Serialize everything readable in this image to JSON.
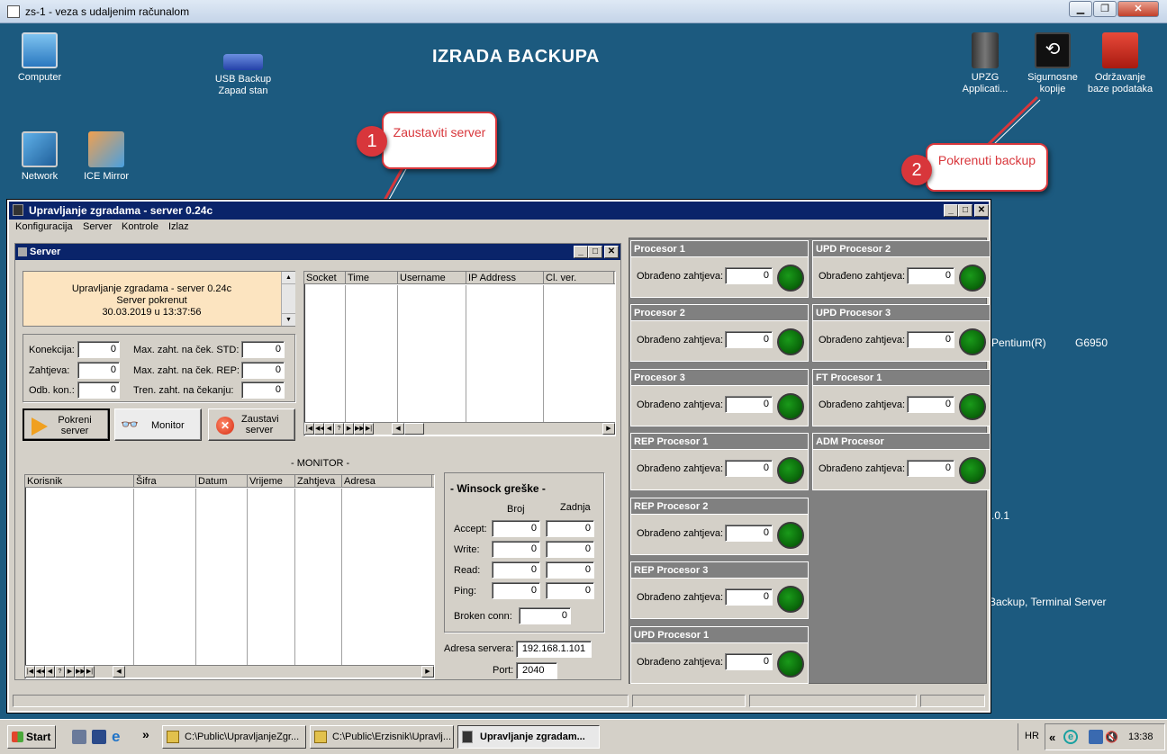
{
  "rdp": {
    "title": "zs-1 - veza s udaljenim računalom",
    "minimize": "▁",
    "restore": "❐",
    "close": "✕"
  },
  "desktop": {
    "banner": "IZRADA BACKUPA",
    "icons": [
      {
        "label": "Computer",
        "icon": "computer-icon"
      },
      {
        "label": "USB Backup Zapad stan",
        "icon": "usb-drive-icon"
      },
      {
        "label": "Network",
        "icon": "network-icon"
      },
      {
        "label": "ICE Mirror",
        "icon": "ice-mirror-icon"
      },
      {
        "label": "UPZG Applicati...",
        "icon": "server-tower-icon"
      },
      {
        "label": "Sigurnosne kopije",
        "icon": "backup-clock-icon"
      },
      {
        "label": "Održavanje baze podataka",
        "icon": "toolbox-icon"
      }
    ],
    "bg_fragments": [
      "Pentium(R)",
      "G6950",
      ".0.1",
      "Backup, Terminal Server"
    ]
  },
  "callouts": [
    {
      "number": "1",
      "text": "Zaustaviti server"
    },
    {
      "number": "2",
      "text": "Pokrenuti backup"
    }
  ],
  "app": {
    "title": "Upravljanje zgradama - server 0.24c",
    "menu": [
      "Konfiguracija",
      "Server",
      "Kontrole",
      "Izlaz"
    ]
  },
  "server": {
    "title": "Server",
    "status_lines": [
      "Upravljanje zgradama - server 0.24c",
      "Server pokrenut",
      "30.03.2019 u 13:37:56"
    ],
    "stats_left": [
      {
        "label": "Konekcija:",
        "value": "0"
      },
      {
        "label": "Zahtjeva:",
        "value": "0"
      },
      {
        "label": "Odb. kon.:",
        "value": "0"
      }
    ],
    "stats_right": [
      {
        "label": "Max. zaht. na ček. STD:",
        "value": "0"
      },
      {
        "label": "Max. zaht. na ček. REP:",
        "value": "0"
      },
      {
        "label": "Tren. zaht. na čekanju:",
        "value": "0"
      }
    ],
    "buttons": {
      "start": "Pokreni server",
      "monitor": "Monitor",
      "stop": "Zaustavi server"
    },
    "conn_columns": [
      "Socket",
      "Time",
      "Username",
      "IP Address",
      "Cl. ver."
    ],
    "monitor_title": "- MONITOR -",
    "monitor_columns": [
      "Korisnik",
      "Šifra",
      "Datum",
      "Vrijeme",
      "Zahtjeva",
      "Adresa"
    ],
    "winsock": {
      "title": "- Winsock greške -",
      "col_broj": "Broj",
      "col_zadnja": "Zadnja",
      "rows": [
        {
          "label": "Accept:",
          "broj": "0",
          "zadnja": "0"
        },
        {
          "label": "Write:",
          "broj": "0",
          "zadnja": "0"
        },
        {
          "label": "Read:",
          "broj": "0",
          "zadnja": "0"
        },
        {
          "label": "Ping:",
          "broj": "0",
          "zadnja": "0"
        }
      ],
      "broken_label": "Broken conn:",
      "broken_value": "0"
    },
    "address_label": "Adresa servera:",
    "address_value": "192.168.1.101",
    "port_label": "Port:",
    "port_value": "2040"
  },
  "processors": {
    "field_label": "Obrađeno zahtjeva:",
    "left": [
      {
        "name": "Procesor 1",
        "value": "0"
      },
      {
        "name": "Procesor 2",
        "value": "0"
      },
      {
        "name": "Procesor 3",
        "value": "0"
      },
      {
        "name": "REP Procesor 1",
        "value": "0"
      },
      {
        "name": "REP Procesor 2",
        "value": "0"
      },
      {
        "name": "REP Procesor 3",
        "value": "0"
      },
      {
        "name": "UPD Procesor 1",
        "value": "0"
      }
    ],
    "right": [
      {
        "name": "UPD Procesor 2",
        "value": "0"
      },
      {
        "name": "UPD Procesor 3",
        "value": "0"
      },
      {
        "name": "FT Procesor 1",
        "value": "0"
      },
      {
        "name": "ADM Procesor",
        "value": "0"
      }
    ]
  },
  "taskbar": {
    "start": "Start",
    "chevron": "»",
    "buttons": [
      "C:\\Public\\UpravljanjeZgr...",
      "C:\\Public\\Erzisnik\\Upravlj...",
      "Upravljanje zgradam..."
    ],
    "lang": "HR",
    "tray_chevron": "«",
    "clock": "13:38"
  },
  "colors": {
    "accent_red": "#d8363b",
    "titlebar": "#0a246a",
    "desktop": "#1c5a7f",
    "led_green": "#0b6b0b"
  }
}
